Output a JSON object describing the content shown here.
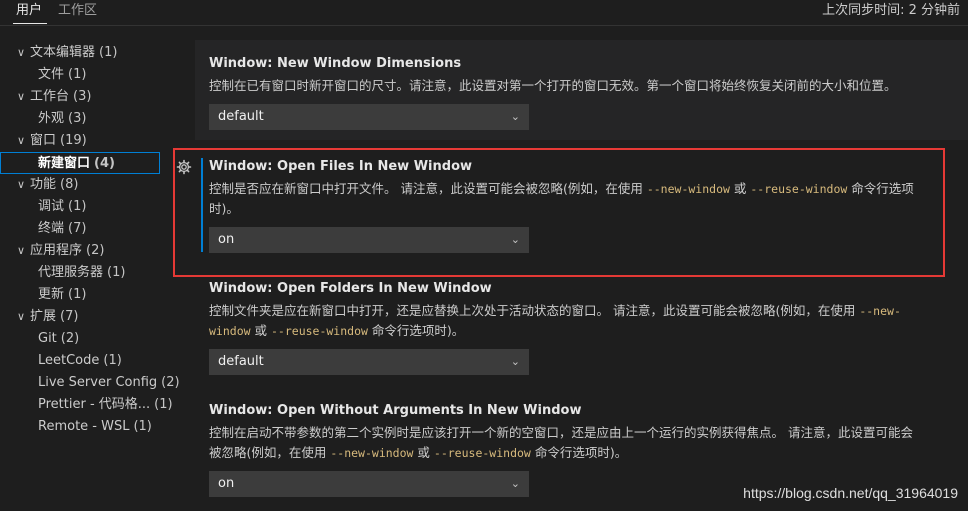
{
  "tabs": {
    "user": "用户",
    "workspace": "工作区",
    "sync_status": "上次同步时间: 2 分钟前"
  },
  "toc": [
    {
      "label": "文本编辑器",
      "count": "(1)",
      "level": 0,
      "expanded": true
    },
    {
      "label": "文件",
      "count": "(1)",
      "level": 1
    },
    {
      "label": "工作台",
      "count": "(3)",
      "level": 0,
      "expanded": true
    },
    {
      "label": "外观",
      "count": "(3)",
      "level": 1
    },
    {
      "label": "窗口",
      "count": "(19)",
      "level": 0,
      "expanded": true
    },
    {
      "label": "新建窗口",
      "count": "(4)",
      "level": 1,
      "selected": true
    },
    {
      "label": "功能",
      "count": "(8)",
      "level": 0,
      "expanded": true
    },
    {
      "label": "调试",
      "count": "(1)",
      "level": 1
    },
    {
      "label": "终端",
      "count": "(7)",
      "level": 1
    },
    {
      "label": "应用程序",
      "count": "(2)",
      "level": 0,
      "expanded": true
    },
    {
      "label": "代理服务器",
      "count": "(1)",
      "level": 1
    },
    {
      "label": "更新",
      "count": "(1)",
      "level": 1
    },
    {
      "label": "扩展",
      "count": "(7)",
      "level": 0,
      "expanded": true
    },
    {
      "label": "Git",
      "count": "(2)",
      "level": 1
    },
    {
      "label": "LeetCode",
      "count": "(1)",
      "level": 1
    },
    {
      "label": "Live Server Config",
      "count": "(2)",
      "level": 1
    },
    {
      "label": "Prettier - 代码格...",
      "count": "(1)",
      "level": 1
    },
    {
      "label": "Remote - WSL",
      "count": "(1)",
      "level": 1
    }
  ],
  "settings": {
    "dims": {
      "category": "Window: ",
      "name": "New Window Dimensions",
      "desc": "控制在已有窗口时新开窗口的尺寸。请注意，此设置对第一个打开的窗口无效。第一个窗口将始终恢复关闭前的大小和位置。",
      "value": "default"
    },
    "files": {
      "category": "Window: ",
      "name": "Open Files In New Window",
      "desc_a": "控制是否应在新窗口中打开文件。 请注意，此设置可能会被忽略(例如，在使用 ",
      "code1": "--new-window",
      "desc_b": " 或 ",
      "code2": "--reuse-window",
      "desc_c": " 命令行选项",
      "desc_d": "时)。",
      "value": "on"
    },
    "folders": {
      "category": "Window: ",
      "name": "Open Folders In New Window",
      "desc_a": "控制文件夹是应在新窗口中打开，还是应替换上次处于活动状态的窗口。 请注意，此设置可能会被忽略(例如，在使用 ",
      "code1a": "--new-",
      "code1b": "window",
      "desc_b": " 或 ",
      "code2": "--reuse-window",
      "desc_c": " 命令行选项时)。",
      "value": "default"
    },
    "noargs": {
      "category": "Window: ",
      "name": "Open Without Arguments In New Window",
      "desc_a": "控制在启动不带参数的第二个实例时是应该打开一个新的空窗口，还是应由上一个运行的实例获得焦点。 请注意，此设置可能会",
      "desc_b": "被忽略(例如，在使用 ",
      "code1": "--new-window",
      "desc_c": " 或 ",
      "code2": "--reuse-window",
      "desc_d": " 命令行选项时)。",
      "value": "on"
    }
  },
  "icons": {
    "chevron_down": "⌄",
    "chevron_tree": "∨",
    "gear": "⚙"
  },
  "colors": {
    "accent": "#007fd4",
    "highlight_box": "#e53935",
    "code": "#d7ba7d"
  },
  "watermark": "https://blog.csdn.net/qq_31964019"
}
